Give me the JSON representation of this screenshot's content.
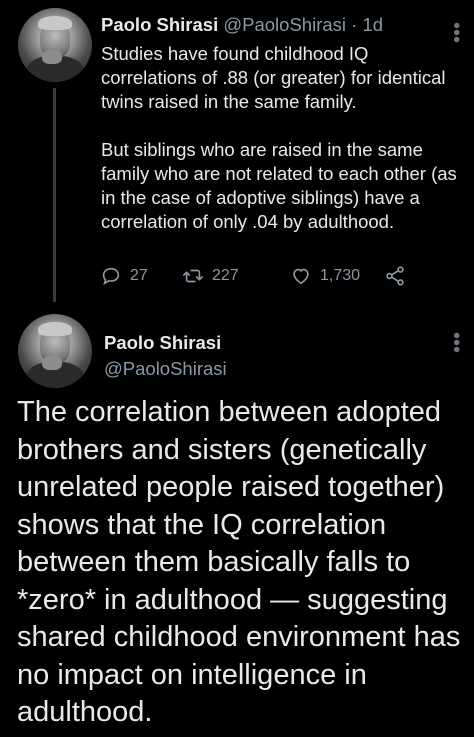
{
  "tweets": [
    {
      "author_name": "Paolo Shirasi",
      "handle": "@PaoloShirasi",
      "time": "· 1d",
      "paragraphs": [
        "Studies have found childhood IQ correlations of .88 (or greater) for identical twins raised in the same family.",
        "But siblings who are raised in the same family who are not related to each other (as in the case of adoptive siblings) have a correlation of only .04 by adulthood."
      ],
      "stats": {
        "replies": "27",
        "retweets": "227",
        "likes": "1,730"
      }
    },
    {
      "author_name": "Paolo Shirasi",
      "handle": "@PaoloShirasi",
      "text": "The correlation between adopted brothers and sisters (genetically unrelated people raised together) shows that the IQ correlation between them basically falls to *zero* in adulthood — suggesting shared childhood environment has no impact on intelligence in adulthood."
    }
  ],
  "icons": {
    "more": "more-dots-icon",
    "reply": "reply-icon",
    "retweet": "retweet-icon",
    "like": "heart-icon",
    "share": "share-icon"
  },
  "colors": {
    "background": "#000000",
    "text": "#e7e9ea",
    "secondary": "#8b98a5"
  }
}
